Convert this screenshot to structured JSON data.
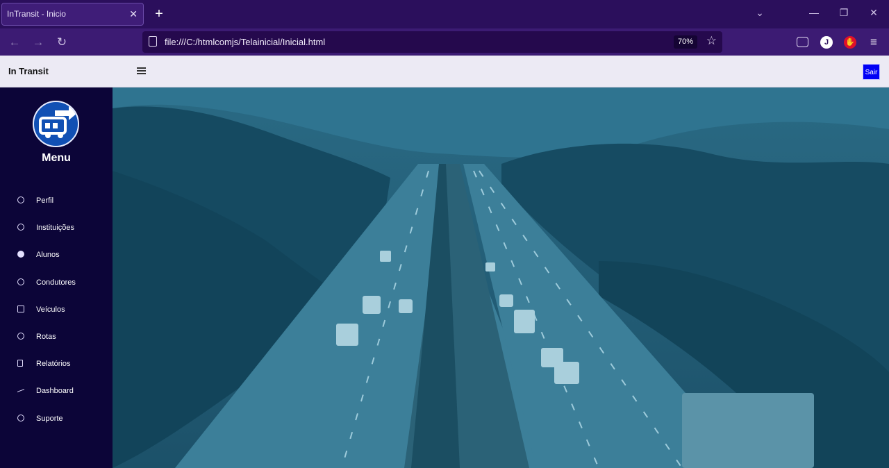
{
  "browser": {
    "tab_title": "InTransit - Inicio",
    "url": "file:///C:/htmlcomjs/Telainicial/Inicial.html",
    "zoom": "70%",
    "profile_initial": "J"
  },
  "header": {
    "brand": "In Transit",
    "logout_label": "Sair"
  },
  "sidebar": {
    "menu_title": "Menu",
    "items": [
      {
        "label": "Perfil",
        "icon": "user-circle-icon"
      },
      {
        "label": "Instituições",
        "icon": "globe-icon"
      },
      {
        "label": "Alunos",
        "icon": "smile-icon"
      },
      {
        "label": "Condutores",
        "icon": "speedometer-icon"
      },
      {
        "label": "Veículos",
        "icon": "grid-icon"
      },
      {
        "label": "Rotas",
        "icon": "compass-icon"
      },
      {
        "label": "Relatórios",
        "icon": "document-icon"
      },
      {
        "label": "Dashboard",
        "icon": "trend-icon"
      },
      {
        "label": "Suporte",
        "icon": "help-icon"
      }
    ]
  },
  "colors": {
    "sidebar_bg": "#0c0538",
    "accent_button": "#0000f5",
    "hero_tint": "#1d5670"
  }
}
